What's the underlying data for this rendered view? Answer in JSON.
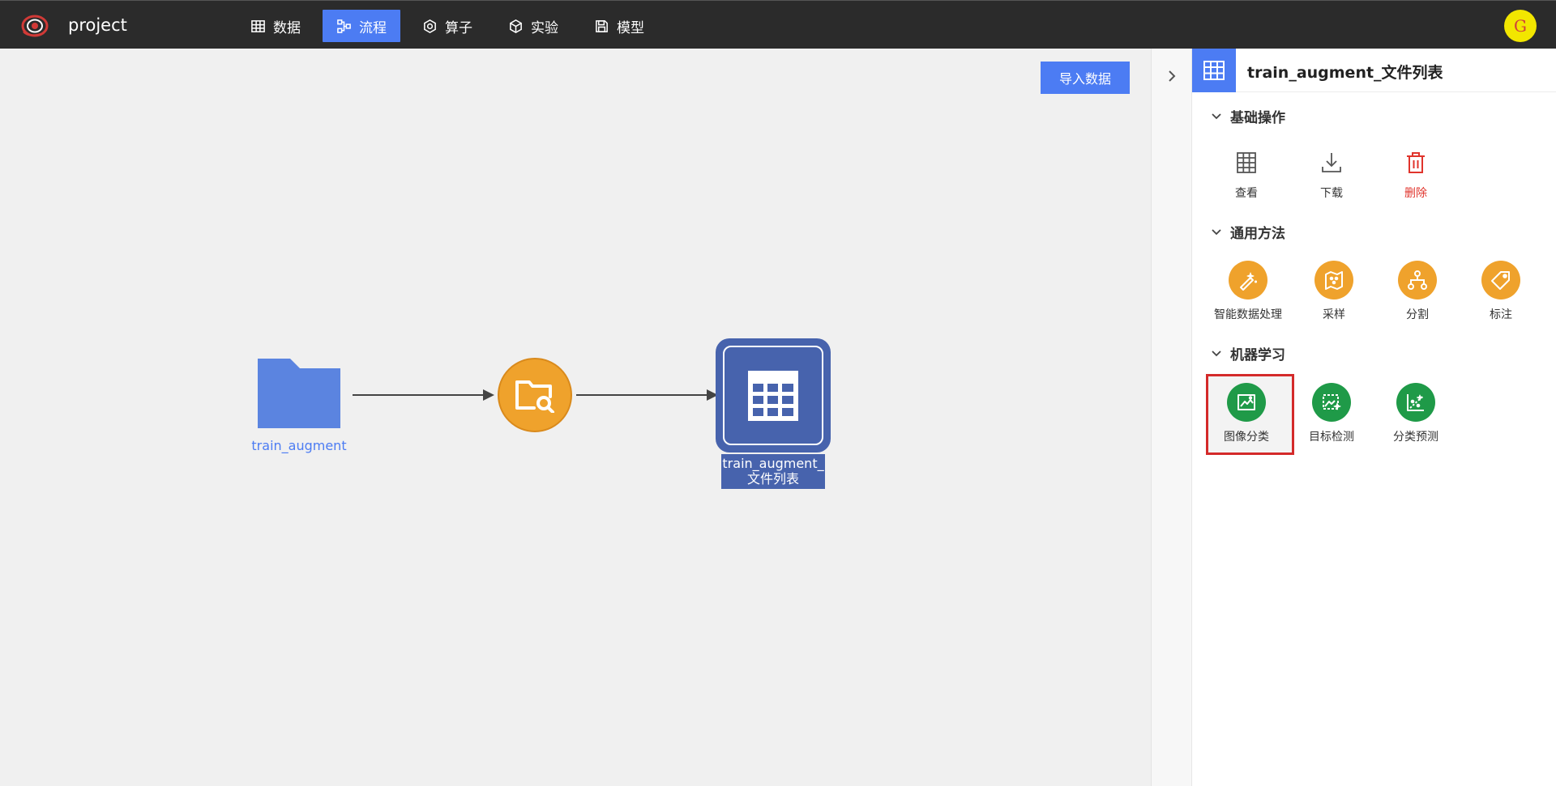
{
  "header": {
    "project_name": "project",
    "nav": [
      {
        "label": "数据",
        "icon": "table-icon",
        "active": false
      },
      {
        "label": "流程",
        "icon": "flow-icon",
        "active": true
      },
      {
        "label": "算子",
        "icon": "hexagon-icon",
        "active": false
      },
      {
        "label": "实验",
        "icon": "cube-icon",
        "active": false
      },
      {
        "label": "模型",
        "icon": "save-icon",
        "active": false
      }
    ],
    "avatar_letter": "G"
  },
  "canvas": {
    "import_button": "导入数据",
    "nodes": [
      {
        "type": "folder",
        "label": "train_augment",
        "color": "#5b84e0"
      },
      {
        "type": "operator",
        "icon": "folder-search-icon",
        "color": "#efa22c"
      },
      {
        "type": "dataset",
        "label_line1": "train_augment_",
        "label_line2": "文件列表",
        "color": "#4763ad"
      }
    ]
  },
  "panel": {
    "title": "train_augment_文件列表",
    "sections": [
      {
        "title": "基础操作",
        "items": [
          {
            "label": "查看",
            "icon": "table-icon"
          },
          {
            "label": "下载",
            "icon": "download-icon"
          },
          {
            "label": "删除",
            "icon": "trash-icon",
            "color": "#e0342c"
          }
        ]
      },
      {
        "title": "通用方法",
        "items": [
          {
            "label": "智能数据处理",
            "icon": "magic-wand-icon"
          },
          {
            "label": "采样",
            "icon": "map-icon"
          },
          {
            "label": "分割",
            "icon": "split-icon"
          },
          {
            "label": "标注",
            "icon": "tag-icon"
          }
        ]
      },
      {
        "title": "机器学习",
        "items": [
          {
            "label": "图像分类",
            "icon": "image-classify-icon",
            "highlighted": true
          },
          {
            "label": "目标检测",
            "icon": "object-detect-icon"
          },
          {
            "label": "分类预测",
            "icon": "scatter-predict-icon"
          }
        ]
      }
    ]
  },
  "colors": {
    "accent": "#4c7cf3",
    "topbar": "#2b2b2b",
    "orange": "#efa22c",
    "green": "#1f9a48",
    "danger": "#e0342c",
    "highlight_border": "#d42a2a"
  }
}
